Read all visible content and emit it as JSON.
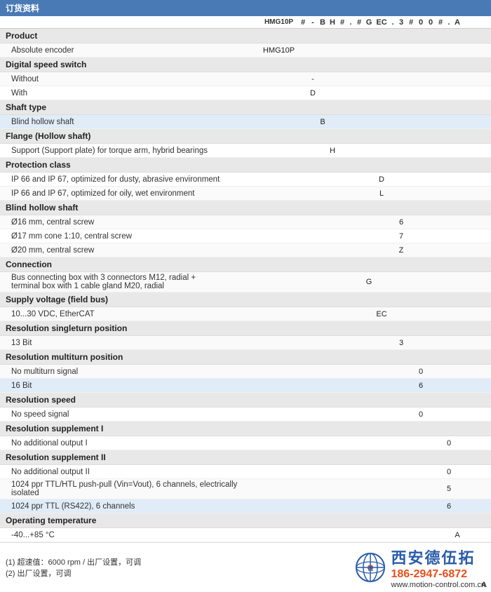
{
  "header": {
    "title": "订货资料",
    "columns": [
      "HMG10P",
      "#",
      "-",
      "B",
      "H",
      "#",
      ".",
      "#",
      "G",
      "EC",
      ".",
      "3",
      "#",
      "0",
      "0",
      "#",
      ".",
      "A"
    ]
  },
  "sections": [
    {
      "id": "product",
      "header": "Product",
      "rows": [
        {
          "label": "Absolute encoder",
          "val": "HMG10P",
          "valCol": 0
        }
      ]
    },
    {
      "id": "digital-speed-switch",
      "header": "Digital speed switch",
      "rows": [
        {
          "label": "Without",
          "val": "-",
          "valCol": 1
        },
        {
          "label": "With",
          "val": "D",
          "valCol": 1
        }
      ]
    },
    {
      "id": "shaft-type",
      "header": "Shaft type",
      "rows": [
        {
          "label": "Blind hollow shaft",
          "val": "B",
          "valCol": 2,
          "highlight": true
        }
      ]
    },
    {
      "id": "flange",
      "header": "Flange (Hollow shaft)",
      "rows": [
        {
          "label": "Support (Support plate) for torque arm, hybrid bearings",
          "val": "H",
          "valCol": 3
        }
      ]
    },
    {
      "id": "protection-class",
      "header": "Protection class",
      "rows": [
        {
          "label": "IP 66 and IP 67, optimized for dusty, abrasive environment",
          "val": "D",
          "valCol": 4
        },
        {
          "label": "IP 66 and IP 67, optimized for oily, wet environment",
          "val": "L",
          "valCol": 4
        }
      ]
    },
    {
      "id": "blind-hollow-shaft",
      "header": "Blind hollow shaft",
      "rows": [
        {
          "label": "Ø16 mm, central screw",
          "val": "6",
          "valCol": 5
        },
        {
          "label": "Ø17 mm cone 1:10, central screw",
          "val": "7",
          "valCol": 5
        },
        {
          "label": "Ø20 mm, central screw",
          "val": "Z",
          "valCol": 5
        }
      ]
    },
    {
      "id": "connection",
      "header": "Connection",
      "rows": [
        {
          "label": "Bus connecting box with 3 connectors M12, radial +\nterminal box with 1 cable gland M20, radial",
          "val": "G",
          "valCol": 6
        }
      ]
    },
    {
      "id": "supply-voltage",
      "header": "Supply voltage (field bus)",
      "rows": [
        {
          "label": "10...30 VDC, EtherCAT",
          "val": "EC",
          "valCol": 7
        }
      ]
    },
    {
      "id": "resolution-singleturn",
      "header": "Resolution singleturn position",
      "rows": [
        {
          "label": "13 Bit",
          "val": "3",
          "valCol": 8
        }
      ]
    },
    {
      "id": "resolution-multiturn",
      "header": "Resolution multiturn position",
      "rows": [
        {
          "label": "No multiturn signal",
          "val": "0",
          "valCol": 9
        },
        {
          "label": "16 Bit",
          "val": "6",
          "valCol": 9,
          "highlight": true
        }
      ]
    },
    {
      "id": "resolution-speed",
      "header": "Resolution speed",
      "rows": [
        {
          "label": "No speed signal",
          "val": "0",
          "valCol": 10
        }
      ]
    },
    {
      "id": "resolution-supplement-i",
      "header": "Resolution supplement I",
      "rows": [
        {
          "label": "No additional output I",
          "val": "0",
          "valCol": 11
        }
      ]
    },
    {
      "id": "resolution-supplement-ii",
      "header": "Resolution supplement II",
      "rows": [
        {
          "label": "No additional output II",
          "val": "0",
          "valCol": 12
        },
        {
          "label": "1024 ppr TTL/HTL push-pull (Vin=Vout), 6 channels, electrically isolated",
          "val": "5",
          "valCol": 12
        },
        {
          "label": "1024 ppr TTL (RS422), 6 channels",
          "val": "6",
          "valCol": 12,
          "highlight": true
        }
      ]
    },
    {
      "id": "operating-temperature",
      "header": "Operating temperature",
      "rows": [
        {
          "label": "-40...+85 °C",
          "val": "A",
          "valCol": 13
        }
      ]
    }
  ],
  "colPositions": [
    {
      "key": "HMG10P",
      "offset": 0
    },
    {
      "key": "#",
      "offset": 1
    },
    {
      "key": "-",
      "offset": 2
    },
    {
      "key": "B",
      "offset": 3
    },
    {
      "key": "H",
      "offset": 4
    },
    {
      "key": "#",
      "offset": 5
    },
    {
      "key": ".",
      "offset": 6
    },
    {
      "key": "#",
      "offset": 7
    },
    {
      "key": "G",
      "offset": 8
    },
    {
      "key": "EC",
      "offset": 9
    },
    {
      "key": ".",
      "offset": 10
    },
    {
      "key": "3",
      "offset": 11
    },
    {
      "key": "#",
      "offset": 12
    },
    {
      "key": "0",
      "offset": 13
    },
    {
      "key": "0",
      "offset": 14
    },
    {
      "key": "#",
      "offset": 15
    },
    {
      "key": ".",
      "offset": 16
    },
    {
      "key": "A",
      "offset": 17
    }
  ],
  "footnotes": [
    "(1) 超速值：6000 rpm / 出厂设置，可调",
    "(2) 出厂设置，可调"
  ],
  "company": {
    "name": "西安德伍拓",
    "phone": "186-2947-6872",
    "url": "www.motion-control.com.cn"
  },
  "right_letter": "A",
  "val_col_map": {
    "0": 370,
    "1": 460,
    "2": 480,
    "3": 500,
    "4": 520,
    "5": 540,
    "6": 560,
    "7": 585,
    "8": 610,
    "9": 625,
    "10": 640,
    "11": 655,
    "12": 670,
    "13": 690
  }
}
